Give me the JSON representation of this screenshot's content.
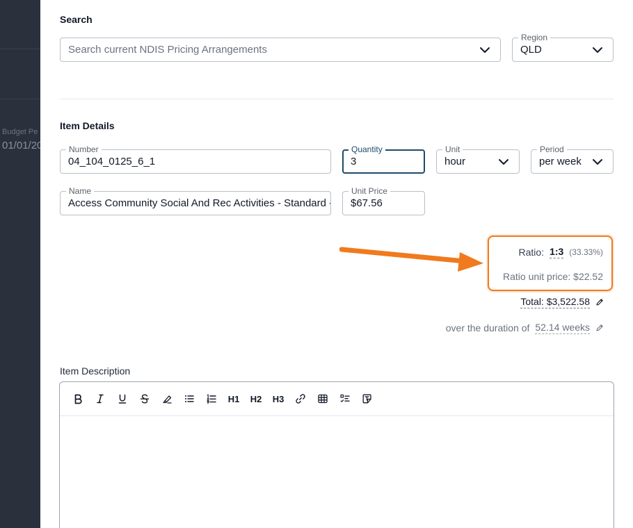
{
  "backdrop": {
    "ghost_label": "Budget Pe",
    "ghost_value": "01/01/20"
  },
  "search": {
    "title": "Search",
    "placeholder": "Search current NDIS Pricing Arrangements",
    "region_label": "Region",
    "region_value": "QLD"
  },
  "item_details": {
    "title": "Item Details",
    "number_label": "Number",
    "number_value": "04_104_0125_6_1",
    "quantity_label": "Quantity",
    "quantity_value": "3",
    "unit_label": "Unit",
    "unit_value": "hour",
    "period_label": "Period",
    "period_value": "per week",
    "name_label": "Name",
    "name_value": "Access Community Social And Rec Activities - Standard - ",
    "unit_price_label": "Unit Price",
    "unit_price_value": "$67.56"
  },
  "ratio": {
    "label": "Ratio:",
    "value": "1:3",
    "percent": "(33.33%)",
    "unit_price": "Ratio unit price: $22.52"
  },
  "total": {
    "text": "Total: $3,522.58"
  },
  "duration": {
    "label": "over the duration of",
    "value": "52.14 weeks"
  },
  "description": {
    "title": "Item Description",
    "toolbar": {
      "h1": "H1",
      "h2": "H2",
      "h3": "H3"
    }
  },
  "colors": {
    "accent": "#f07a1d",
    "focus": "#1d4a6b",
    "backdrop": "#2a313c"
  }
}
